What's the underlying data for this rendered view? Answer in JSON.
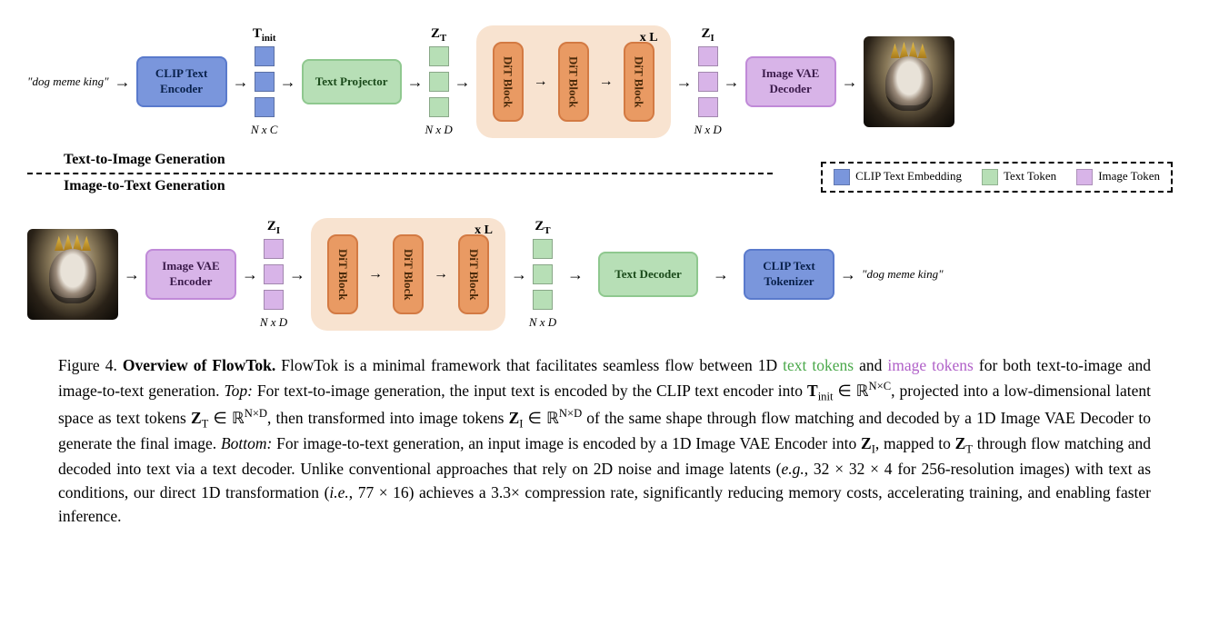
{
  "diagram": {
    "text_in": "\"dog meme king\"",
    "text_out": "\"dog meme king\"",
    "clip_text_encoder": "CLIP Text Encoder",
    "text_projector": "Text Projector",
    "image_vae_decoder": "Image VAE Decoder",
    "image_vae_encoder": "Image VAE Encoder",
    "text_decoder": "Text Decoder",
    "clip_text_tokenizer": "CLIP Text Tokenizer",
    "dit_block": "DiT Block",
    "xL": "x L",
    "Tinit_label": "T",
    "Tinit_sub": "init",
    "ZT_label": "Z",
    "ZT_sub": "T",
    "ZI_label": "Z",
    "ZI_sub": "I",
    "NxC": "N x C",
    "NxD": "N x D",
    "t2i_label": "Text-to-Image Generation",
    "i2t_label": "Image-to-Text Generation",
    "legend": {
      "clip": "CLIP Text Embedding",
      "text": "Text Token",
      "image": "Image Token"
    }
  },
  "caption": {
    "fig": "Figure 4.",
    "title": "Overview of FlowTok.",
    "s1a": " FlowTok is a minimal framework that facilitates seamless flow between 1D ",
    "s1_text_tokens": "text tokens",
    "s1b": " and ",
    "s1_image_tokens": "image tokens",
    "s1c": " for both text-to-image and image-to-text generation. ",
    "top_label": "Top:",
    "s2a": " For text-to-image generation, the input text is encoded by the CLIP text encoder into ",
    "Tinit_tex": "T",
    "Tinit_sub_tex": "init",
    "in_RNC": " ∈ ℝ",
    "NxC_sup": "N×C",
    "s2b": ", projected into a low-dimensional latent space as text tokens ",
    "ZT_tex": "Z",
    "ZT_sub_tex": "T",
    "in_RND": " ∈ ℝ",
    "NxD_sup": "N×D",
    "s2c": ", then transformed into image tokens ",
    "ZI_tex": "Z",
    "ZI_sub_tex": "I",
    "s2d": " of the same shape through flow matching and decoded by a 1D Image VAE Decoder to generate the final image. ",
    "bottom_label": "Bottom:",
    "s3": " For image-to-text generation, an input image is encoded by a 1D Image VAE Encoder into ",
    "s3b": ", mapped to ",
    "s3c": " through flow matching and decoded into text via a text decoder. Unlike conventional approaches that rely on 2D noise and image latents (",
    "eg": "e.g.",
    "s3d": ", 32 × 32 × 4 for 256-resolution images) with text as conditions, our direct 1D transformation (",
    "ie": "i.e.",
    "s3e": ", 77 × 16) achieves a 3.3× compression rate, significantly reducing memory costs, accelerating training, and enabling faster inference."
  }
}
